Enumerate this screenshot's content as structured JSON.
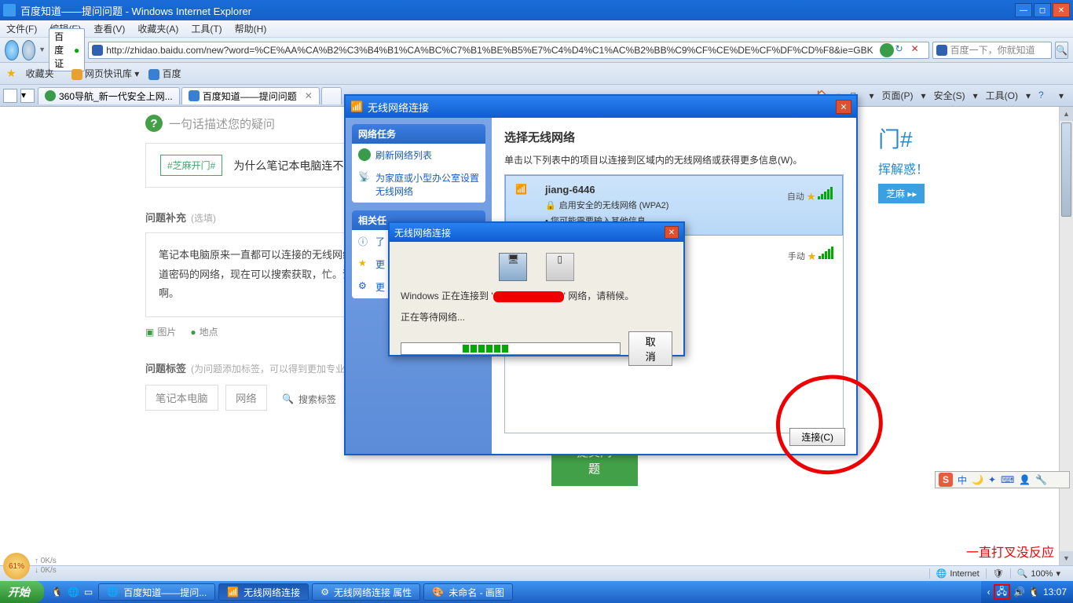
{
  "window": {
    "title": "百度知道——提问问题 - Windows Internet Explorer"
  },
  "menu": [
    "文件(F)",
    "编辑(E)",
    "查看(V)",
    "收藏夹(A)",
    "工具(T)",
    "帮助(H)"
  ],
  "nav": {
    "addr_label": "百度 证",
    "url": "http://zhidao.baidu.com/new?word=%CE%AA%CA%B2%C3%B4%B1%CA%BC%C7%B1%BE%B5%E7%C4%D4%C1%AC%B2%BB%C9%CF%CE%DE%CF%DF%CD%F8&ie=GBK",
    "search_placeholder": "百度一下，你就知道"
  },
  "favbar": {
    "label": "收藏夹",
    "item1": "网页快讯库",
    "item2": "百度"
  },
  "tabs": [
    {
      "label": "360导航_新一代安全上网..."
    },
    {
      "label": "百度知道——提问问题",
      "active": true
    }
  ],
  "cmdbar": [
    "页面(P)",
    "安全(S)",
    "工具(O)"
  ],
  "page": {
    "heading": "一句话描述您的疑问",
    "hashtag": "#芝麻开门#",
    "example": "为什么笔记本电脑连不",
    "supp_label": "问题补充",
    "supp_hint": "(选填)",
    "body": "笔记本电脑原来一直都可以连接的无线网络连接图标还是打叉，原来都是搜索，他不知道密码的网络，现在可以搜索获取，忙。谢谢！！！而且我发现连接手机热点有关系啊。",
    "attach_img": "图片",
    "attach_loc": "地点",
    "tags_label": "问题标签",
    "tags_hint": "(为问题添加标签，可以得到更加专业",
    "tag1": "笔记本电脑",
    "tag2": "网络",
    "tag_search": "搜索标签",
    "submit": "提交问题",
    "promo_big": "门#",
    "promo_sub": "挥解惑！",
    "promo_btn": "芝麻 ▸▸"
  },
  "xp": {
    "title": "无线网络连接",
    "tasks_hdr": "网络任务",
    "task1": "刷新网络列表",
    "task2": "为家庭或小型办公室设置无线网络",
    "related_hdr": "相关任",
    "rel1": "了",
    "rel2": "更",
    "rel3": "更",
    "main_hdr": "选择无线网络",
    "main_desc": "单击以下列表中的项目以连接到区域内的无线网络或获得更多信息(W)。",
    "net1_name": "jiang-6446",
    "net1_sec": "启用安全的无线网络 (WPA2)",
    "net1_auto": "自动",
    "net1_extra": "您可能需要输入其他信息。",
    "net2_manual": "手动",
    "connect_btn": "连接(C)"
  },
  "dlg": {
    "title": "无线网络连接",
    "line1a": "Windows 正在连接到 '",
    "line1b": "' 网络，请稍候。",
    "line2": "正在等待网络...",
    "cancel": "取消"
  },
  "annotation": {
    "text": "一直打叉没反应"
  },
  "status": {
    "internet": "Internet",
    "zoom": "100%"
  },
  "taskbar": {
    "start": "开始",
    "btns": [
      "百度知道——提问...",
      "无线网络连接",
      "无线网络连接 属性",
      "未命名 - 画图"
    ],
    "time": "13:07"
  },
  "meter": {
    "pct": "61%",
    "up": "0K/s",
    "dn": "0K/s"
  },
  "ime": {
    "mode": "中"
  }
}
